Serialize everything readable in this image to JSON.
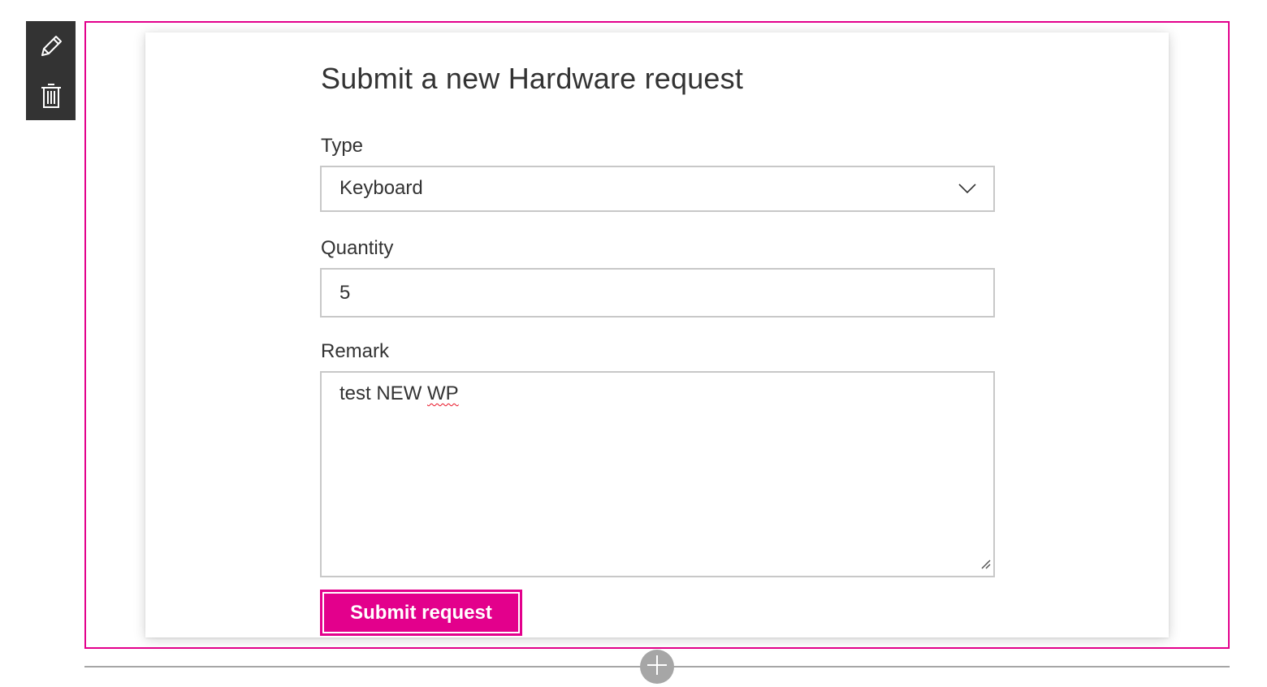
{
  "toolbar": {
    "edit_icon": "pencil-icon",
    "delete_icon": "trash-icon"
  },
  "form": {
    "title": "Submit a new Hardware request",
    "type": {
      "label": "Type",
      "selected_value": "Keyboard",
      "icon": "chevron-down-icon"
    },
    "quantity": {
      "label": "Quantity",
      "value": "5"
    },
    "remark": {
      "label": "Remark",
      "value_prefix": "test NEW ",
      "value_flagged": "WP"
    },
    "submit_label": "Submit request"
  },
  "canvas": {
    "add_section_icon": "plus-icon"
  },
  "colors": {
    "accent": "#e3008c",
    "toolbar_bg": "#333333",
    "text": "#333333",
    "input_border": "#c8c8c8",
    "divider": "#a6a6a6",
    "spellcheck": "#e81123"
  }
}
